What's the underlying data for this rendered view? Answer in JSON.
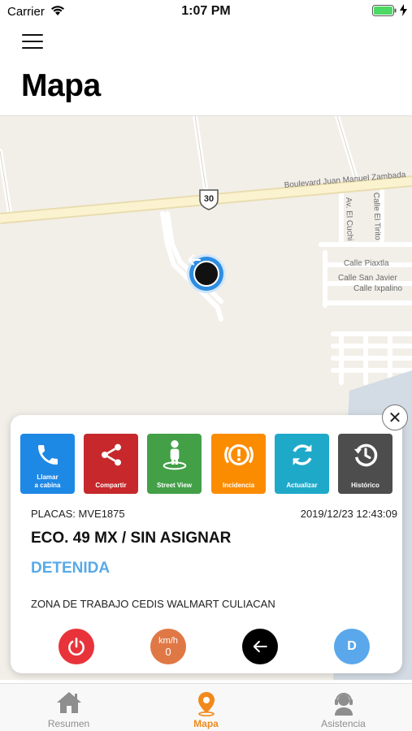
{
  "status_bar": {
    "carrier": "Carrier",
    "time": "1:07 PM"
  },
  "header": {
    "title": "Mapa",
    "menu_icon": "hamburger-menu-icon"
  },
  "map": {
    "route_shield": "30",
    "streets": {
      "boulevard": "Boulevard Juan Manuel Zambada",
      "el_cuchi": "Av. El Cuchi",
      "el_tirito": "Calle El Tirito",
      "piaxtla": "Calle Piaxtla",
      "san_javier": "Calle San Javier",
      "ixpalino": "Calle Ixpalino"
    }
  },
  "card": {
    "actions": [
      {
        "label_line1": "Llamar",
        "label_line2": "a cabina",
        "icon": "phone-icon",
        "color": "#1e88e5"
      },
      {
        "label_line1": "Compartir",
        "label_line2": "",
        "icon": "share-icon",
        "color": "#c6282b"
      },
      {
        "label_line1": "Street View",
        "label_line2": "",
        "icon": "person-icon",
        "color": "#43a047"
      },
      {
        "label_line1": "Incidencia",
        "label_line2": "",
        "icon": "alert-icon",
        "color": "#fb8c00"
      },
      {
        "label_line1": "Actualizar",
        "label_line2": "",
        "icon": "refresh-icon",
        "color": "#1fa9c9"
      },
      {
        "label_line1": "Histórico",
        "label_line2": "",
        "icon": "clock-history-icon",
        "color": "#4d4d4d"
      }
    ],
    "plate": "PLACAS: MVE1875",
    "timestamp": "2019/12/23 12:43:09",
    "unit": "ECO. 49 MX / SIN ASIGNAR",
    "state": "DETENIDA",
    "zone": "ZONA DE TRABAJO CEDIS WALMART CULIACAN",
    "speed_unit": "km/h",
    "speed_value": "0",
    "driver_badge": "D"
  },
  "tabs": [
    {
      "label": "Resumen",
      "icon": "home-icon",
      "active": false
    },
    {
      "label": "Mapa",
      "icon": "map-pin-icon",
      "active": true
    },
    {
      "label": "Asistencia",
      "icon": "support-agent-icon",
      "active": false
    }
  ],
  "colors": {
    "accent": "#f08a1d",
    "state_blue": "#58a9e8"
  }
}
